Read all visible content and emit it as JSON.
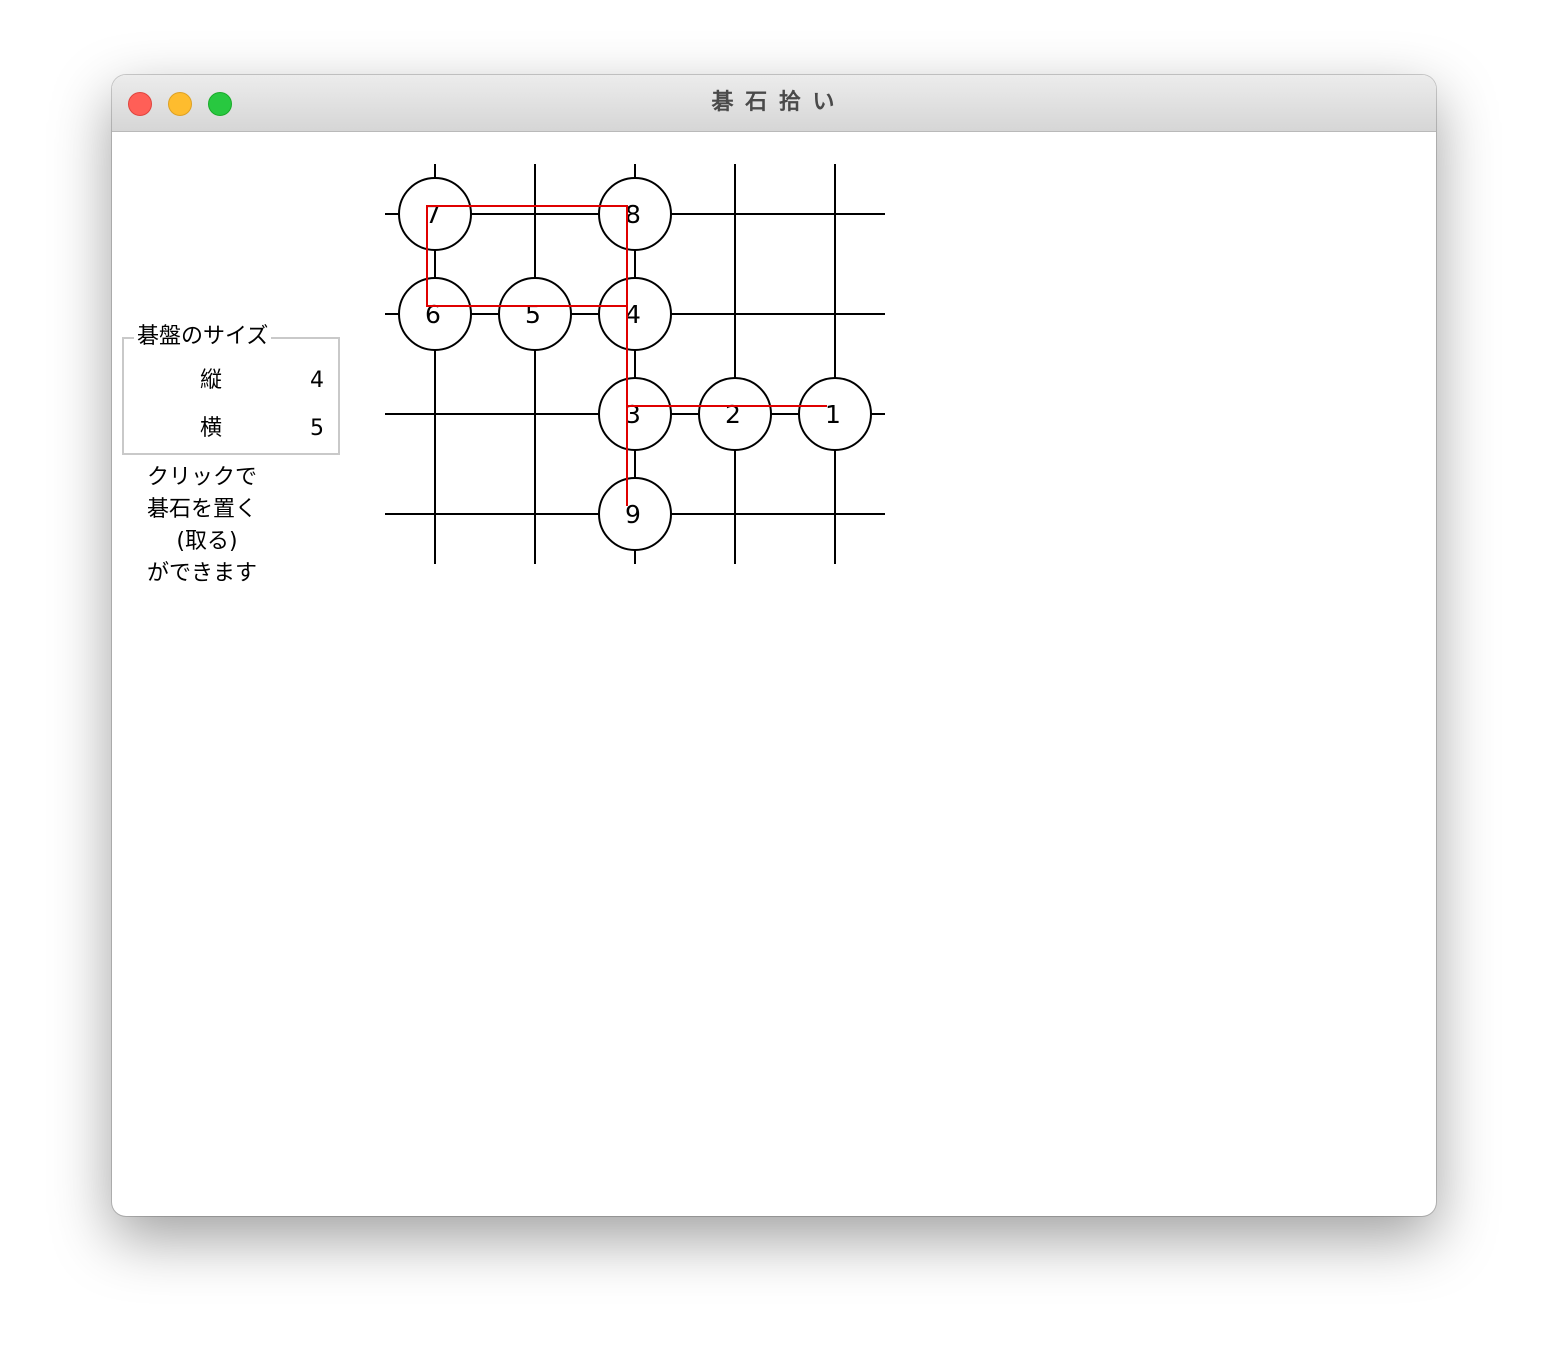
{
  "window": {
    "title": "碁 石 拾 い"
  },
  "board_size": {
    "legend": "碁盤のサイズ",
    "rows_label": "縦",
    "rows_value": "4",
    "cols_label": "横",
    "cols_value": "5"
  },
  "help": {
    "lines": [
      "クリックで",
      "碁石を置く",
      "(取る)",
      "ができます"
    ]
  },
  "board": {
    "rows": 4,
    "cols": 5,
    "line_color": "#000000",
    "path_color": "#e00000",
    "stones": [
      {
        "label": "1",
        "row": 2,
        "col": 4
      },
      {
        "label": "2",
        "row": 2,
        "col": 3
      },
      {
        "label": "3",
        "row": 2,
        "col": 2
      },
      {
        "label": "4",
        "row": 1,
        "col": 2
      },
      {
        "label": "5",
        "row": 1,
        "col": 1
      },
      {
        "label": "6",
        "row": 1,
        "col": 0
      },
      {
        "label": "7",
        "row": 0,
        "col": 0
      },
      {
        "label": "8",
        "row": 0,
        "col": 2
      },
      {
        "label": "9",
        "row": 3,
        "col": 2
      }
    ]
  }
}
